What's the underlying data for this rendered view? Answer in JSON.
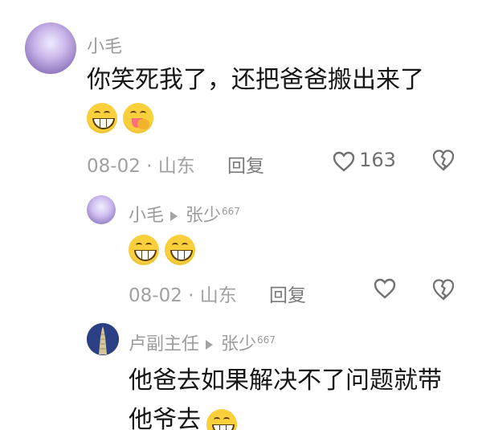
{
  "comments": [
    {
      "name": "小毛",
      "content": "你笑死我了，还把爸爸搬出来了",
      "meta": "08-02 · 山东",
      "reply_label": "回复",
      "likes": "163",
      "emoji": [
        "grin-emoji",
        "tongue-emoji"
      ]
    },
    {
      "name": "小毛",
      "reply_target": "张少",
      "reply_target_suffix": "667",
      "meta": "08-02 · 山东",
      "reply_label": "回复",
      "emoji": [
        "grin-emoji",
        "grin-emoji"
      ]
    },
    {
      "name": "卢副主任",
      "reply_target": "张少",
      "reply_target_suffix": "667",
      "content": "他爸去如果解决不了问题就带",
      "content_partial": "他爷去"
    }
  ]
}
